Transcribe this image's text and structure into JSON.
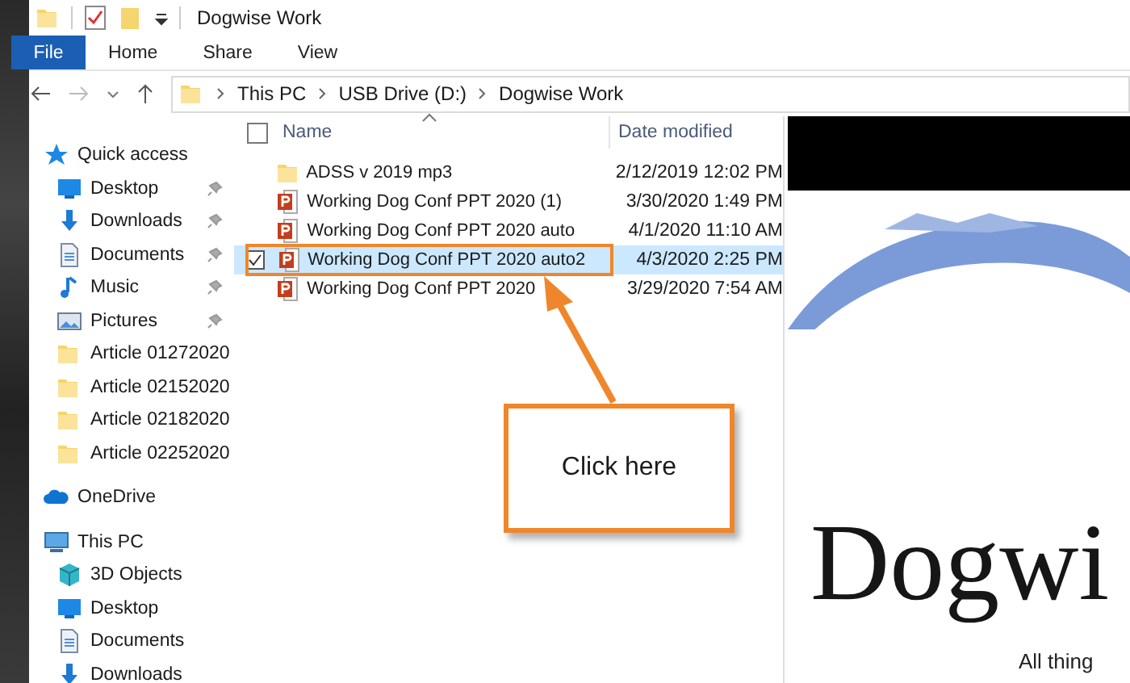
{
  "window": {
    "title": "Dogwise Work"
  },
  "ribbon_tabs": [
    {
      "label": "File",
      "kind": "file"
    },
    {
      "label": "Home",
      "kind": "tab"
    },
    {
      "label": "Share",
      "kind": "tab"
    },
    {
      "label": "View",
      "kind": "tab"
    }
  ],
  "address_bar": {
    "path": [
      "This PC",
      "USB Drive (D:)",
      "Dogwise Work"
    ]
  },
  "nav_pane": {
    "items": [
      {
        "label": "Quick access",
        "kind": "star",
        "children": [
          {
            "label": "Desktop",
            "kind": "desktop",
            "pinned": true
          },
          {
            "label": "Downloads",
            "kind": "downloads",
            "pinned": true
          },
          {
            "label": "Documents",
            "kind": "documents",
            "pinned": true
          },
          {
            "label": "Music",
            "kind": "music",
            "pinned": true
          },
          {
            "label": "Pictures",
            "kind": "pictures",
            "pinned": true
          },
          {
            "label": "Article 01272020",
            "kind": "folder",
            "pinned": false
          },
          {
            "label": "Article 02152020",
            "kind": "folder",
            "pinned": false
          },
          {
            "label": "Article 02182020",
            "kind": "folder",
            "pinned": false
          },
          {
            "label": "Article 02252020",
            "kind": "folder",
            "pinned": false
          }
        ]
      },
      {
        "label": "OneDrive",
        "kind": "cloud"
      },
      {
        "label": "This PC",
        "kind": "pc",
        "children": [
          {
            "label": "3D Objects",
            "kind": "cube",
            "pinned": false
          },
          {
            "label": "Desktop",
            "kind": "desktop",
            "pinned": false
          },
          {
            "label": "Documents",
            "kind": "documents",
            "pinned": false
          },
          {
            "label": "Downloads",
            "kind": "downloads",
            "pinned": false
          }
        ]
      }
    ]
  },
  "file_list": {
    "columns": [
      "Name",
      "Date modified"
    ],
    "select_all": {
      "checked": false
    },
    "rows": [
      {
        "name": "ADSS v 2019 mp3",
        "date": "2/12/2019 12:02 PM",
        "kind": "folder",
        "selected": false
      },
      {
        "name": "Working Dog Conf PPT 2020 (1)",
        "date": "3/30/2020 1:49 PM",
        "kind": "ppt",
        "selected": false
      },
      {
        "name": "Working Dog Conf PPT 2020 auto",
        "date": "4/1/2020 11:10 AM",
        "kind": "ppt",
        "selected": false
      },
      {
        "name": "Working Dog Conf PPT 2020 auto2",
        "date": "4/3/2020 2:25 PM",
        "kind": "ppt",
        "selected": true,
        "highlighted": true
      },
      {
        "name": "Working Dog Conf PPT 2020",
        "date": "3/29/2020 7:54 AM",
        "kind": "ppt",
        "selected": false
      }
    ]
  },
  "preview": {
    "logo": "Dogwi",
    "tagline": "All thing"
  },
  "callout": {
    "text": "Click here"
  }
}
